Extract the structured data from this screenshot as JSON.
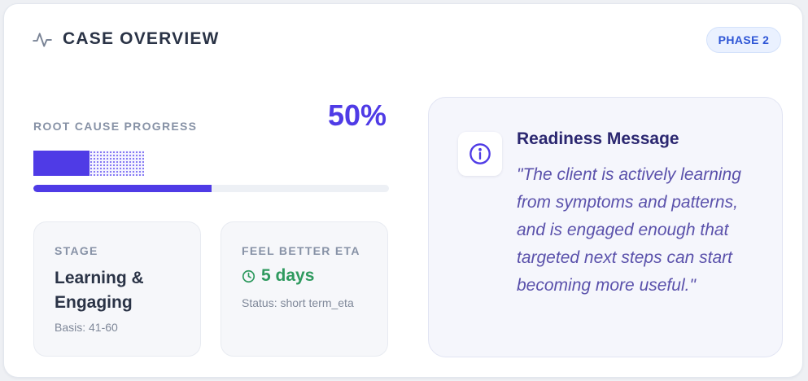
{
  "header": {
    "title": "CASE OVERVIEW",
    "icon": "activity-pulse-icon",
    "phase_badge": "PHASE 2"
  },
  "progress": {
    "label": "ROOT CAUSE PROGRESS",
    "percent_text": "50%",
    "fraction": 0.5,
    "blocks_filled": 1,
    "blocks_total": 2
  },
  "stage": {
    "label": "STAGE",
    "value": "Learning & Engaging",
    "basis": "Basis: 41-60"
  },
  "eta": {
    "label": "FEEL BETTER ETA",
    "icon": "clock-icon",
    "value": "5 days",
    "status": "Status: short term_eta"
  },
  "readiness": {
    "icon": "info-icon",
    "title": "Readiness Message",
    "message": "\"The client is actively learning from symptoms and patterns, and is engaged enough that targeted next steps can start becoming more useful.\""
  },
  "colors": {
    "accent": "#4f3be6",
    "success": "#2f9a5f",
    "badge_text": "#2d55d6",
    "message_text": "#5a51ab"
  }
}
